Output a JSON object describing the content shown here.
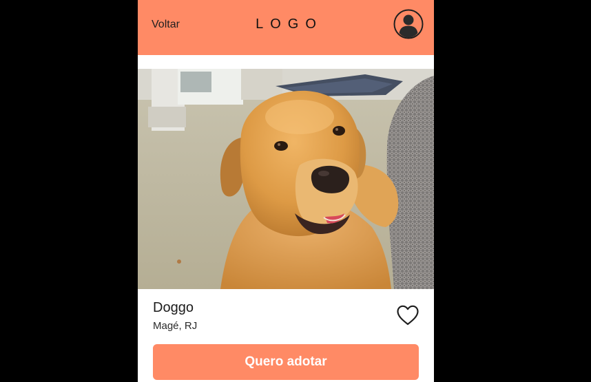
{
  "header": {
    "back_label": "Voltar",
    "logo_text": "LOGO",
    "profile_icon": "user-circle-icon",
    "background_color": "#ff8a65"
  },
  "pet": {
    "photo_subject": "dog-photo",
    "name": "Doggo",
    "location": "Magé, RJ",
    "favorite_icon": "heart-outline-icon"
  },
  "actions": {
    "adopt_label": "Quero adotar",
    "adopt_color": "#ff8a65"
  }
}
